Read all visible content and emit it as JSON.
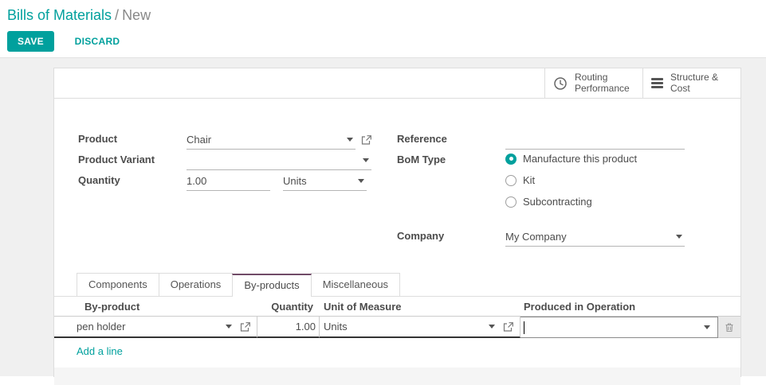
{
  "breadcrumb": {
    "section": "Bills of Materials",
    "separator": "/",
    "current": "New"
  },
  "actions": {
    "save": "SAVE",
    "discard": "DISCARD"
  },
  "stat_buttons": {
    "routing": {
      "line1": "Routing",
      "line2": "Performance",
      "icon": "clock-icon"
    },
    "structure": {
      "line1": "Structure &",
      "line2": "Cost",
      "icon": "bars-icon"
    }
  },
  "form": {
    "product": {
      "label": "Product",
      "value": "Chair"
    },
    "product_variant": {
      "label": "Product Variant",
      "value": ""
    },
    "quantity": {
      "label": "Quantity",
      "value": "1.00",
      "uom": "Units"
    },
    "reference": {
      "label": "Reference",
      "value": ""
    },
    "bom_type": {
      "label": "BoM Type",
      "options": [
        {
          "label": "Manufacture this product",
          "selected": true
        },
        {
          "label": "Kit",
          "selected": false
        },
        {
          "label": "Subcontracting",
          "selected": false
        }
      ]
    },
    "company": {
      "label": "Company",
      "value": "My Company"
    }
  },
  "tabs": [
    {
      "label": "Components",
      "active": false
    },
    {
      "label": "Operations",
      "active": false
    },
    {
      "label": "By-products",
      "active": true
    },
    {
      "label": "Miscellaneous",
      "active": false
    }
  ],
  "byproducts_table": {
    "columns": [
      "By-product",
      "Quantity",
      "Unit of Measure",
      "Produced in Operation"
    ],
    "rows": [
      {
        "by_product": "pen holder",
        "quantity": "1.00",
        "uom": "Units",
        "produced_in_operation": ""
      }
    ],
    "add_line_label": "Add a line"
  },
  "colors": {
    "accent": "#00A09D",
    "active_tab_border": "#714B67",
    "page_background": "#f0f0f0"
  }
}
